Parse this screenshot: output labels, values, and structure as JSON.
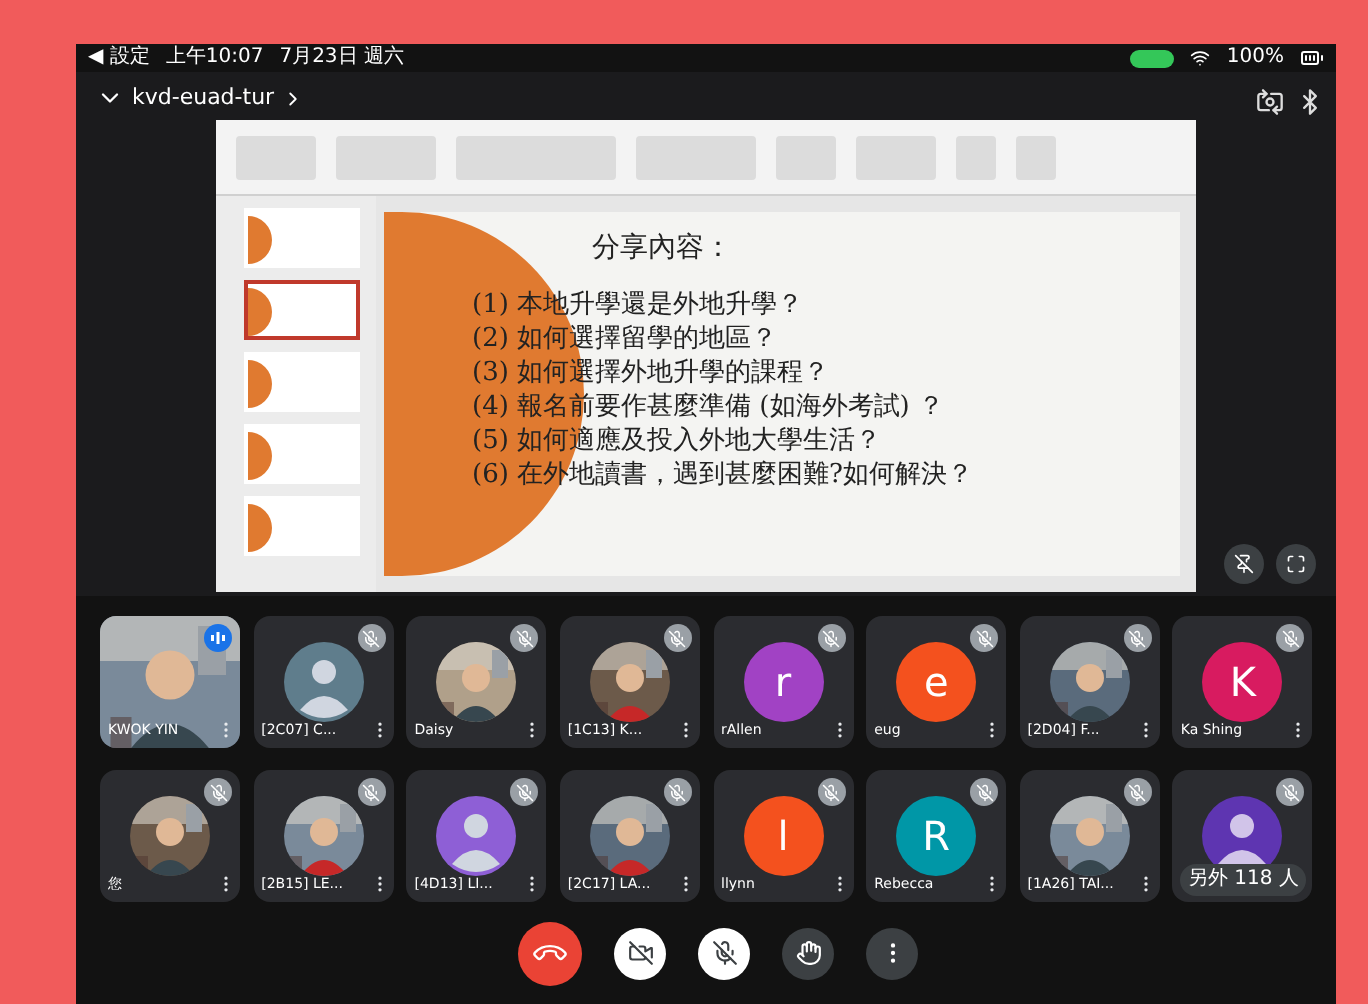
{
  "status_bar": {
    "back": "◀ 設定",
    "time": "上午10:07",
    "date": "7月23日 週六",
    "battery": "100%"
  },
  "meeting": {
    "code": "kvd-euad-tur"
  },
  "shared_screen": {
    "slide_title": "分享內容：",
    "slide_items": [
      "(1)  本地升學還是外地升學？",
      "(2)  如何選擇留學的地區？",
      "(3)  如何選擇外地升學的課程？",
      "(4)  報名前要作甚麼準備 (如海外考試) ？",
      "(5)  如何適應及投入外地大學生活？",
      "(6)  在外地讀書，遇到甚麼困難?如何解決？"
    ],
    "thumbnails": [
      {
        "selected": false
      },
      {
        "selected": true
      },
      {
        "selected": false
      },
      {
        "selected": false
      },
      {
        "selected": false
      }
    ]
  },
  "participants": [
    {
      "name": "KWOK YIN",
      "kind": "video",
      "muted": false
    },
    {
      "name": "[2C07] C...",
      "kind": "default",
      "muted": true
    },
    {
      "name": "Daisy",
      "muted": true
    },
    {
      "name": "[1C13] K...",
      "muted": true
    },
    {
      "name": "rAllen",
      "kind": "letter",
      "letter": "r",
      "color": "#a142c4",
      "muted": true
    },
    {
      "name": "eug",
      "kind": "letter",
      "letter": "e",
      "color": "#f4511e",
      "muted": true
    },
    {
      "name": "[2D04] F...",
      "muted": true
    },
    {
      "name": "Ka Shing",
      "kind": "letter",
      "letter": "K",
      "color": "#d81b60",
      "muted": true
    },
    {
      "name": "您",
      "muted": true
    },
    {
      "name": "[2B15] LE...",
      "muted": true
    },
    {
      "name": "[4D13] LI...",
      "kind": "default",
      "muted": true
    },
    {
      "name": "[2C17] LA...",
      "muted": true
    },
    {
      "name": "llynn",
      "kind": "letter",
      "letter": "l",
      "color": "#f4511e",
      "muted": true
    },
    {
      "name": "Rebecca",
      "kind": "letter",
      "letter": "R",
      "color": "#0097a7",
      "muted": true
    },
    {
      "name": "[1A26] TAI...",
      "muted": true
    },
    {
      "name": "另外 118 人",
      "kind": "overflow",
      "muted": true
    }
  ],
  "controls": [
    {
      "kind": "end-call"
    },
    {
      "kind": "camera-off"
    },
    {
      "kind": "mic-off"
    },
    {
      "kind": "raise-hand"
    },
    {
      "kind": "more"
    }
  ]
}
